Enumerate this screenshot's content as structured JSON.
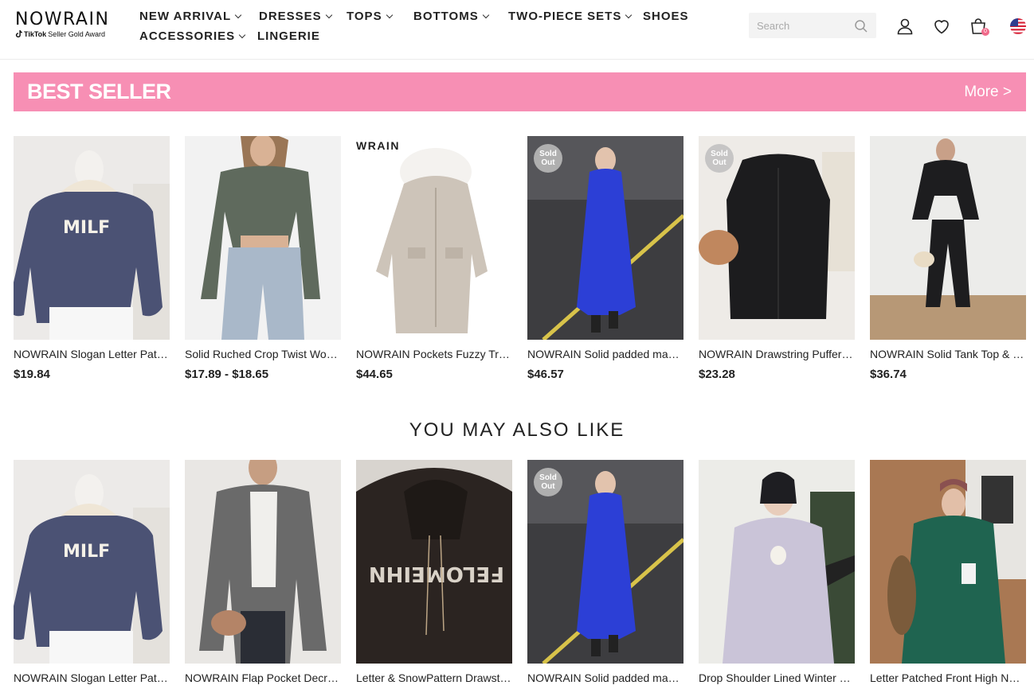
{
  "logo": {
    "word": "NOWRAIN",
    "tag_brand": "TikTok",
    "tag_rest": "Seller Gold Award"
  },
  "nav": [
    {
      "label": "NEW ARRIVAL",
      "dropdown": true
    },
    {
      "label": "DRESSES",
      "dropdown": true
    },
    {
      "label": "TOPS",
      "dropdown": true
    },
    {
      "label": "BOTTOMS",
      "dropdown": true
    },
    {
      "label": "TWO-PIECE SETS",
      "dropdown": true
    },
    {
      "label": "SHOES",
      "dropdown": false
    },
    {
      "label": "ACCESSORIES",
      "dropdown": true
    },
    {
      "label": "LINGERIE",
      "dropdown": false
    }
  ],
  "search": {
    "placeholder": "Search"
  },
  "cart": {
    "count": "0"
  },
  "best_seller": {
    "title": "BEST SELLER",
    "more": "More >",
    "products": [
      {
        "name": "NOWRAIN Slogan Letter Patched Hoodie",
        "price": "$19.84",
        "sold_out": "",
        "stamp": ""
      },
      {
        "name": "Solid Ruched Crop Twist Women Top",
        "price": "$17.89 - $18.65",
        "sold_out": "",
        "stamp": ""
      },
      {
        "name": "NOWRAIN Pockets Fuzzy Trim Hooded Coat",
        "price": "$44.65",
        "sold_out": "",
        "stamp": "WRAIN"
      },
      {
        "name": "NOWRAIN Solid padded maxi puffer coat",
        "price": "$46.57",
        "sold_out": "Sold Out",
        "stamp": ""
      },
      {
        "name": "NOWRAIN Drawstring Puffer Vest",
        "price": "$23.28",
        "sold_out": "Sold Out",
        "stamp": ""
      },
      {
        "name": "NOWRAIN Solid Tank Top & Jogger Set",
        "price": "$36.74",
        "sold_out": "",
        "stamp": ""
      }
    ]
  },
  "you_may_also_like": {
    "title": "YOU MAY ALSO LIKE",
    "products": [
      {
        "name": "NOWRAIN Slogan Letter Patched Hoodie",
        "sold_out": ""
      },
      {
        "name": "NOWRAIN Flap Pocket Decro Jacket",
        "sold_out": ""
      },
      {
        "name": "Letter & SnowPattern Drawstring Hoodie",
        "sold_out": ""
      },
      {
        "name": "NOWRAIN Solid padded maxi puffer coat",
        "sold_out": "Sold Out"
      },
      {
        "name": "Drop Shoulder Lined Winter Coat",
        "sold_out": ""
      },
      {
        "name": "Letter Patched Front High Neck Jacket",
        "sold_out": ""
      }
    ]
  },
  "colors": {
    "banner": "#f78fb4",
    "text": "#222222",
    "badge": "#f06a8a"
  }
}
